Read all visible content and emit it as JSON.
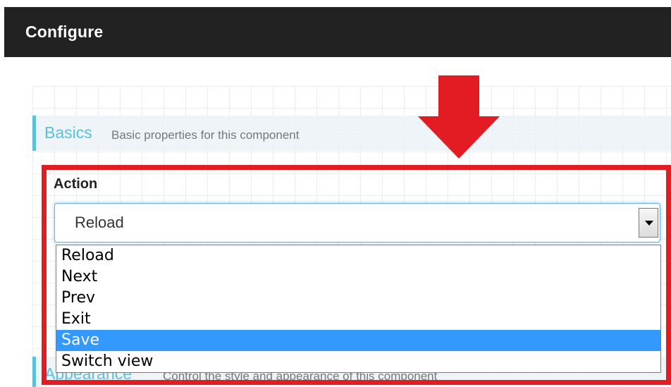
{
  "header": {
    "title": "Configure"
  },
  "sections": {
    "basics": {
      "title": "Basics",
      "description": "Basic properties for this component"
    },
    "appearance": {
      "title": "Appearance",
      "description": "Control the style and appearance of this component"
    }
  },
  "action_field": {
    "label": "Action",
    "selected_value": "Reload",
    "options": [
      "Reload",
      "Next",
      "Prev",
      "Exit",
      "Save",
      "Switch view"
    ],
    "highlighted_option": "Save"
  },
  "annotations": {
    "arrow_icon": "down-arrow-icon",
    "highlight_color": "#e31b23"
  },
  "colors": {
    "header_background": "#222222",
    "accent": "#5bc0de",
    "selection": "#3399ff"
  }
}
